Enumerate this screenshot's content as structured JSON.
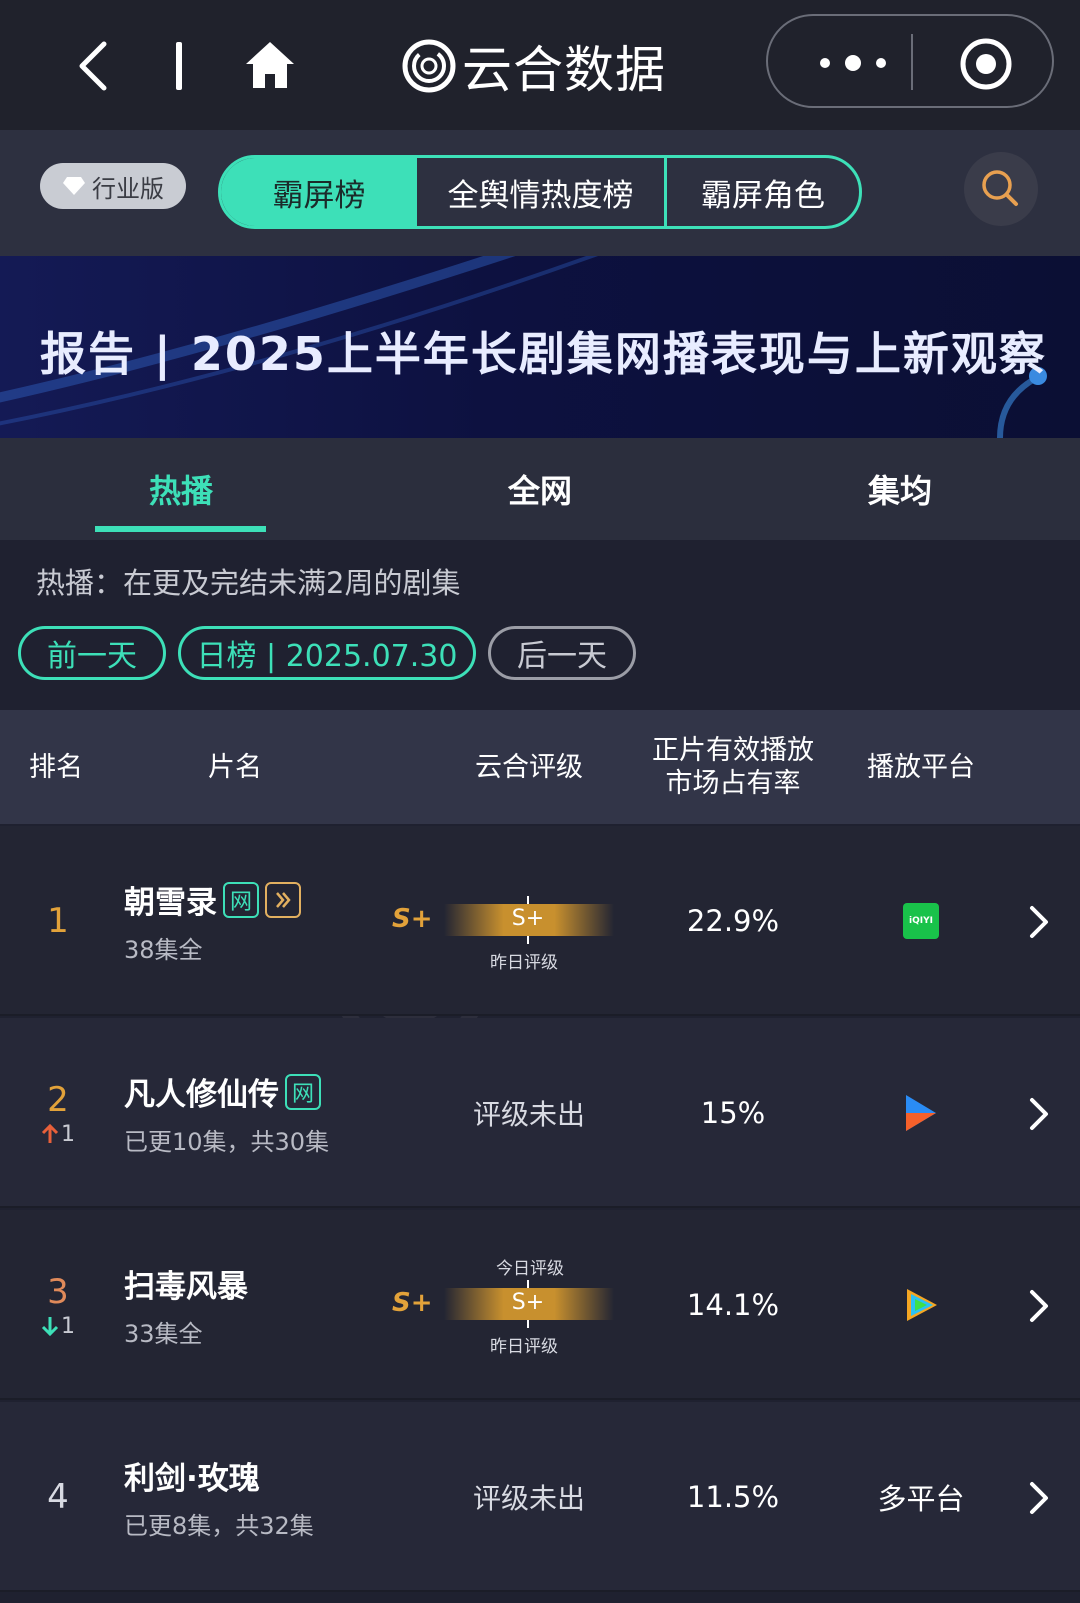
{
  "nav": {
    "brand_title": "云合数据",
    "icons": [
      "back-icon",
      "home-icon",
      "more-icon",
      "target-icon"
    ]
  },
  "categories": {
    "edition_badge": "行业版",
    "tabs": [
      "霸屏榜",
      "全舆情热度榜",
      "霸屏角色"
    ],
    "active_index": 0
  },
  "banner": {
    "title": "报告 | 2025上半年长剧集网播表现与上新观察"
  },
  "tabs": {
    "items": [
      "热播",
      "全网",
      "集均"
    ],
    "active_index": 0
  },
  "description": "热播：在更及完结未满2周的剧集",
  "date_nav": {
    "prev": "前一天",
    "current": "日榜 | 2025.07.30",
    "next": "后一天"
  },
  "table": {
    "headers": {
      "rank": "排名",
      "title": "片名",
      "rating": "云合评级",
      "share": "正片有效播放\n市场占有率",
      "platform": "播放平台"
    },
    "rows": [
      {
        "rank": "1",
        "trend": "",
        "title": "朝雪录",
        "tags": [
          "网",
          "▷"
        ],
        "sub": "38集全",
        "rating_grade": "S+",
        "rating_bar": "S+",
        "rating_top_label": "",
        "rating_bottom_label": "昨日评级",
        "share": "22.9%",
        "platform": "iQIYI"
      },
      {
        "rank": "2",
        "trend": "1",
        "trend_dir": "up",
        "title": "凡人修仙传",
        "tags": [
          "网"
        ],
        "sub": "已更10集，共30集",
        "rating_text": "评级未出",
        "share": "15%",
        "platform": ""
      },
      {
        "rank": "3",
        "trend": "1",
        "trend_dir": "down",
        "title": "扫毒风暴",
        "tags": [],
        "sub": "33集全",
        "rating_grade": "S+",
        "rating_bar": "S+",
        "rating_top_label": "今日评级",
        "rating_bottom_label": "昨日评级",
        "share": "14.1%",
        "platform": ""
      },
      {
        "rank": "4",
        "trend": "",
        "title": "利剑·玫瑰",
        "tags": [],
        "sub": "已更8集，共32集",
        "rating_text": "评级未出",
        "share": "11.5%",
        "platform": "多平台"
      }
    ]
  },
  "colors": {
    "accent": "#3de0b8",
    "gold": "#e2a23a",
    "up": "#e8603a",
    "down": "#3de0b8"
  }
}
